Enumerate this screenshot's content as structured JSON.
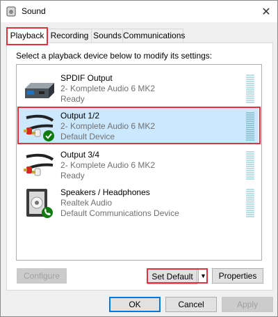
{
  "window": {
    "title": "Sound",
    "close_glyph": "✕"
  },
  "tabs": [
    {
      "label": "Playback",
      "active": true
    },
    {
      "label": "Recording",
      "active": false
    },
    {
      "label": "Sounds",
      "active": false
    },
    {
      "label": "Communications",
      "active": false
    }
  ],
  "instruction": "Select a playback device below to modify its settings:",
  "devices": [
    {
      "name": "SPDIF Output",
      "description": "2- Komplete Audio 6 MK2",
      "status": "Ready",
      "icon": "spdif-box-icon",
      "selected": false
    },
    {
      "name": "Output 1/2",
      "description": "2- Komplete Audio 6 MK2",
      "status": "Default Device",
      "icon": "rca-cable-default-icon",
      "selected": true
    },
    {
      "name": "Output 3/4",
      "description": "2- Komplete Audio 6 MK2",
      "status": "Ready",
      "icon": "rca-cable-icon",
      "selected": false
    },
    {
      "name": "Speakers / Headphones",
      "description": "Realtek Audio",
      "status": "Default Communications Device",
      "icon": "speaker-comm-icon",
      "selected": false
    }
  ],
  "buttons": {
    "configure": "Configure",
    "set_default": "Set Default",
    "set_default_arrow": "▼",
    "properties": "Properties",
    "ok": "OK",
    "cancel": "Cancel",
    "apply": "Apply"
  },
  "colors": {
    "selection": "#cce8ff",
    "highlight_frame": "#e0323e",
    "check_badge": "#107c10"
  }
}
